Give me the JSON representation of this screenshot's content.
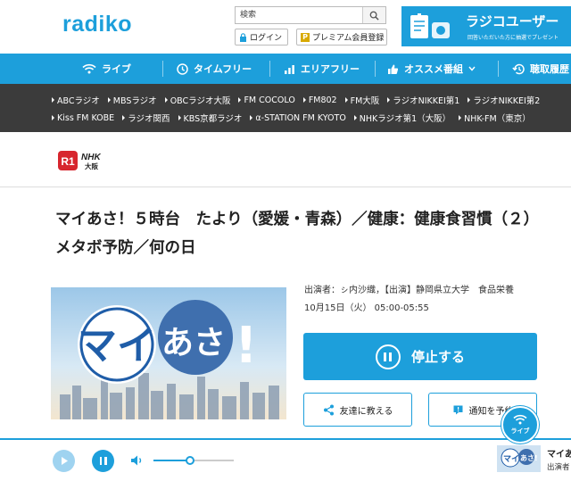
{
  "header": {
    "logo": "radiko",
    "search_placeholder": "検索",
    "login_label": "ログイン",
    "premium_mark": "P",
    "premium_label": "プレミアム会員登録",
    "banner_title": "ラジコユーザー",
    "banner_sub": "回答いただいた方に抽選でプレゼント"
  },
  "nav": {
    "items": [
      {
        "label": "ライブ",
        "icon": "wifi-icon"
      },
      {
        "label": "タイムフリー",
        "icon": "clock-icon"
      },
      {
        "label": "エリアフリー",
        "icon": "chart-icon"
      },
      {
        "label": "オススメ番組",
        "icon": "thumbs-up-icon"
      },
      {
        "label": "聴取履歴",
        "icon": "history-icon"
      }
    ]
  },
  "stations": {
    "row1": [
      "ABCラジオ",
      "MBSラジオ",
      "OBCラジオ大阪",
      "FM COCOLO",
      "FM802",
      "FM大阪",
      "ラジオNIKKEI第1",
      "ラジオNIKKEI第2"
    ],
    "row2": [
      "Kiss FM KOBE",
      "ラジオ関西",
      "KBS京都ラジオ",
      "α-STATION FM KYOTO",
      "NHKラジオ第1（大阪）",
      "NHK-FM（東京）"
    ]
  },
  "station_logo": {
    "mark": "R1",
    "nhk": "NHK",
    "city": "大阪"
  },
  "program": {
    "title": "マイあさ！５時台　たより（愛媛・青森）／健康：健康食習慣（２）メタボ予防／何の日",
    "thumb_text": "マイあさ！",
    "performers": "出演者：ㇱ内沙織，【出演】静岡県立大学　食品栄養",
    "datetime": "10月15日（火） 05:00-05:55",
    "stop_label": "停止する",
    "share_label": "友達に教える",
    "notify_label": "通知を予約"
  },
  "live_badge": {
    "label": "ライブ"
  },
  "player": {
    "volume": 0.45,
    "mini_title": "マイあ",
    "mini_sub": "出演者"
  },
  "colors": {
    "brand": "#1d9fdb",
    "station_bar": "#3b3b3b"
  }
}
